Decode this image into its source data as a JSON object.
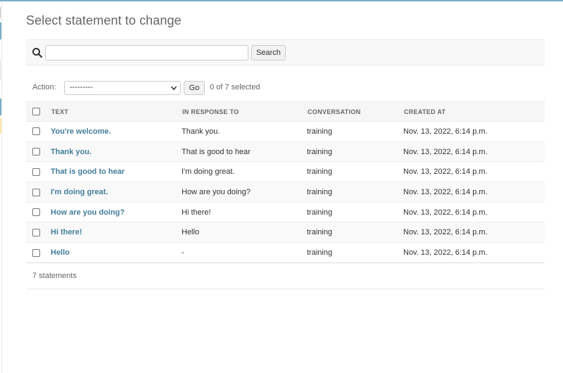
{
  "page": {
    "title": "Select statement to change"
  },
  "search": {
    "value": "",
    "placeholder": "",
    "button_label": "Search"
  },
  "actions": {
    "label": "Action:",
    "selected_option": "---------",
    "go_label": "Go",
    "selected_count": "0 of 7 selected"
  },
  "table": {
    "headers": {
      "text": "Text",
      "in_response_to": "In response to",
      "conversation": "Conversation",
      "created_at": "Created at"
    },
    "rows": [
      {
        "text": "You're welcome.",
        "in_response_to": "Thank you.",
        "conversation": "training",
        "created_at": "Nov. 13, 2022, 6:14 p.m."
      },
      {
        "text": "Thank you.",
        "in_response_to": "That is good to hear",
        "conversation": "training",
        "created_at": "Nov. 13, 2022, 6:14 p.m."
      },
      {
        "text": "That is good to hear",
        "in_response_to": "I'm doing great.",
        "conversation": "training",
        "created_at": "Nov. 13, 2022, 6:14 p.m."
      },
      {
        "text": "I'm doing great.",
        "in_response_to": "How are you doing?",
        "conversation": "training",
        "created_at": "Nov. 13, 2022, 6:14 p.m."
      },
      {
        "text": "How are you doing?",
        "in_response_to": "Hi there!",
        "conversation": "training",
        "created_at": "Nov. 13, 2022, 6:14 p.m."
      },
      {
        "text": "Hi there!",
        "in_response_to": "Hello",
        "conversation": "training",
        "created_at": "Nov. 13, 2022, 6:14 p.m."
      },
      {
        "text": "Hello",
        "in_response_to": "-",
        "conversation": "training",
        "created_at": "Nov. 13, 2022, 6:14 p.m."
      }
    ]
  },
  "paginator": {
    "count_label": "7 statements"
  },
  "icons": {
    "search": "search-icon",
    "select_chevron": "chevron-down-icon",
    "row_checkbox": "checkbox-icon"
  },
  "colors": {
    "link": "#447e9b",
    "accent": "#79aec8",
    "header_bg": "#f6f6f6"
  }
}
